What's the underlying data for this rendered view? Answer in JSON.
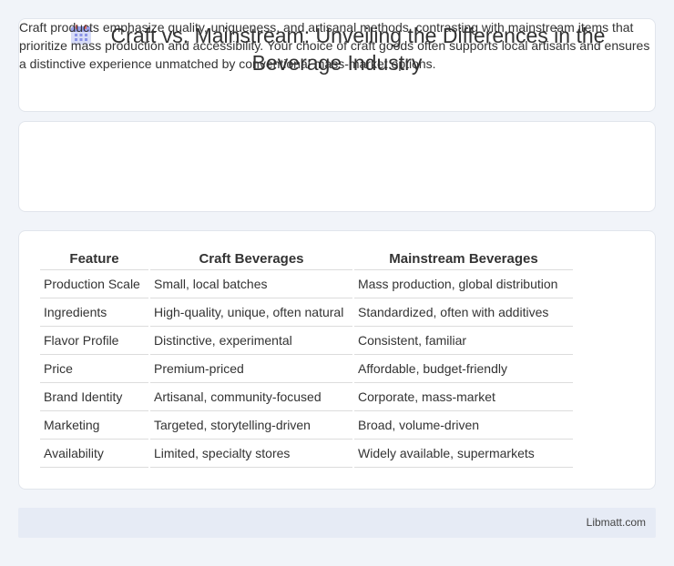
{
  "header": {
    "icon": "calendar-grid-icon",
    "title_line1": "Craft vs. Mainstream: Unveiling the Differences in the",
    "title_line2": "Beverage Industry"
  },
  "intro": {
    "text": "Craft products emphasize quality, uniqueness, and artisanal methods, contrasting with mainstream items that prioritize mass production and accessibility. Your choice of craft goods often supports local artisans and ensures a distinctive experience unmatched by conventional mass-market options."
  },
  "table": {
    "headers": [
      "Feature",
      "Craft Beverages",
      "Mainstream Beverages"
    ],
    "rows": [
      [
        "Production Scale",
        "Small, local batches",
        "Mass production, global distribution"
      ],
      [
        "Ingredients",
        "High-quality, unique, often natural",
        "Standardized, often with additives"
      ],
      [
        "Flavor Profile",
        "Distinctive, experimental",
        "Consistent, familiar"
      ],
      [
        "Price",
        "Premium-priced",
        "Affordable, budget-friendly"
      ],
      [
        "Brand Identity",
        "Artisanal, community-focused",
        "Corporate, mass-market"
      ],
      [
        "Marketing",
        "Targeted, storytelling-driven",
        "Broad, volume-driven"
      ],
      [
        "Availability",
        "Limited, specialty stores",
        "Widely available, supermarkets"
      ]
    ]
  },
  "footer": {
    "site": "Libmatt.com"
  },
  "colors": {
    "background": "#f1f4f9",
    "card": "#ffffff",
    "footer": "#e6ebf5",
    "icon_accent": "#8a93e6"
  }
}
